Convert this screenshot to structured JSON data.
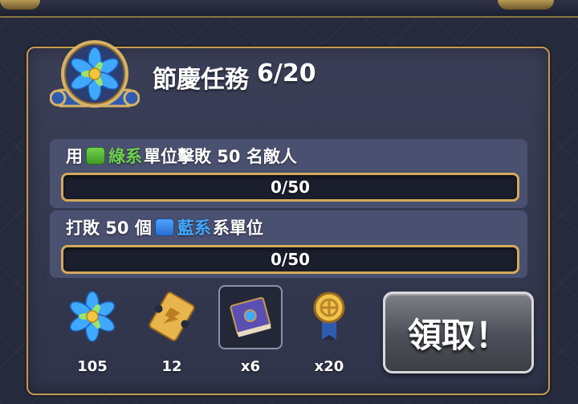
{
  "quest": {
    "title": "節慶任務",
    "progress": "6/20",
    "emblem_icon": "blue-flower-scroll-icon"
  },
  "tasks": [
    {
      "prefix": "用",
      "element_color": "#6fd34b",
      "element_label": "綠系",
      "suffix": "單位擊敗 50 名敵人",
      "progress_text": "0/50",
      "progress_fraction": 0
    },
    {
      "prefix": "打敗 50 個",
      "element_color": "#3fa8ff",
      "element_label": "藍系",
      "suffix": "系單位",
      "progress_text": "0/50",
      "progress_fraction": 0
    }
  ],
  "rewards": [
    {
      "icon": "blue-flower-icon",
      "quantity": "105"
    },
    {
      "icon": "gold-ticket-icon",
      "quantity": "12"
    },
    {
      "icon": "spellbook-icon",
      "quantity": "x6",
      "highlighted": true
    },
    {
      "icon": "gold-medal-icon",
      "quantity": "x20"
    }
  ],
  "claim_button": {
    "label": "領取！"
  },
  "colors": {
    "panel_border": "#c39a4f",
    "green": "#6fd34b",
    "blue": "#3fa8ff"
  }
}
